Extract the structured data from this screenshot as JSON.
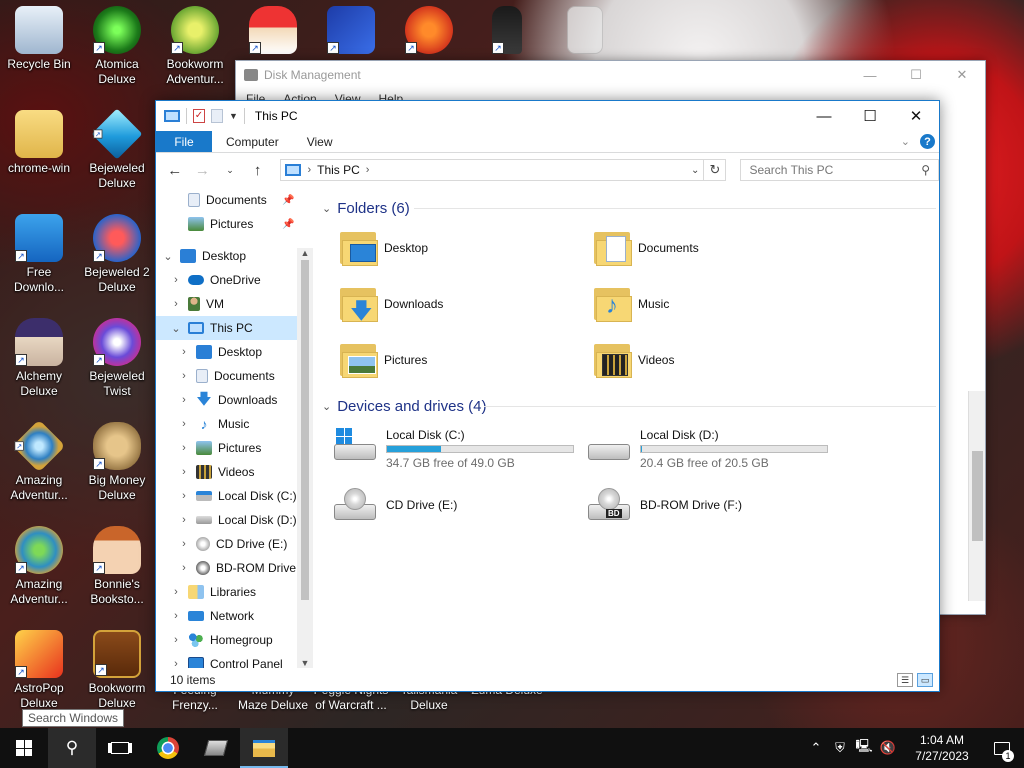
{
  "desktop": {
    "icons": [
      {
        "label": "Recycle Bin",
        "icon": "recycle-bin-icon"
      },
      {
        "label": "Atomica\nDeluxe",
        "icon": "atomica-icon"
      },
      {
        "label": "Bookworm\nAdventur...",
        "icon": "bookworm-adventures-icon"
      },
      {
        "label": "chrome-win",
        "icon": "folder-icon"
      },
      {
        "label": "Bejeweled\nDeluxe",
        "icon": "bejeweled-icon"
      },
      {
        "label": "Free\nDownlo...",
        "icon": "free-download-icon"
      },
      {
        "label": "Bejeweled 2\nDeluxe",
        "icon": "bejeweled-2-icon"
      },
      {
        "label": "Alchemy\nDeluxe",
        "icon": "alchemy-icon"
      },
      {
        "label": "Bejeweled\nTwist",
        "icon": "bejeweled-twist-icon"
      },
      {
        "label": "Amazing\nAdventur...",
        "icon": "amazing-adventures-icon"
      },
      {
        "label": "Big Money\nDeluxe",
        "icon": "big-money-icon"
      },
      {
        "label": "Amazing\nAdventur...",
        "icon": "amazing-adventures-2-icon"
      },
      {
        "label": "Bonnie's\nBooksto...",
        "icon": "bonnies-bookstore-icon"
      },
      {
        "label": "AstroPop\nDeluxe",
        "icon": "astropop-icon"
      },
      {
        "label": "Bookworm\nDeluxe",
        "icon": "bookworm-deluxe-icon"
      }
    ],
    "hidden_labels": [
      "Feeding\nFrenzy...",
      "Mummy\nMaze Deluxe",
      "Peggle Nights\nof Warcraft ...",
      "Talismania\nDeluxe",
      "Zuma Deluxe"
    ],
    "tooltip": "Search Windows"
  },
  "disk_management": {
    "title": "Disk Management",
    "menu": [
      "File",
      "Action",
      "View",
      "Help"
    ]
  },
  "explorer": {
    "title": "This PC",
    "ribbon_tabs": [
      "File",
      "Computer",
      "View"
    ],
    "address": {
      "crumb": "This PC"
    },
    "search_placeholder": "Search This PC",
    "nav": [
      {
        "label": "Documents",
        "icon": "documents-icon",
        "pinned": true
      },
      {
        "label": "Pictures",
        "icon": "pictures-icon",
        "pinned": true
      },
      {
        "label": "Desktop",
        "icon": "desktop-icon"
      },
      {
        "label": "OneDrive",
        "icon": "onedrive-icon"
      },
      {
        "label": "VM",
        "icon": "user-icon"
      },
      {
        "label": "This PC",
        "icon": "this-pc-icon"
      },
      {
        "label": "Desktop",
        "icon": "desktop-icon"
      },
      {
        "label": "Documents",
        "icon": "documents-icon"
      },
      {
        "label": "Downloads",
        "icon": "downloads-icon"
      },
      {
        "label": "Music",
        "icon": "music-icon"
      },
      {
        "label": "Pictures",
        "icon": "pictures-icon"
      },
      {
        "label": "Videos",
        "icon": "videos-icon"
      },
      {
        "label": "Local Disk (C:)",
        "icon": "hard-drive-icon"
      },
      {
        "label": "Local Disk (D:)",
        "icon": "hard-drive-icon"
      },
      {
        "label": "CD Drive (E:)",
        "icon": "cd-drive-icon"
      },
      {
        "label": "BD-ROM Drive",
        "icon": "bd-drive-icon"
      },
      {
        "label": "Libraries",
        "icon": "libraries-icon"
      },
      {
        "label": "Network",
        "icon": "network-icon"
      },
      {
        "label": "Homegroup",
        "icon": "homegroup-icon"
      },
      {
        "label": "Control Panel",
        "icon": "control-panel-icon"
      }
    ],
    "folders_header": "Folders (6)",
    "folders": [
      {
        "name": "Desktop",
        "icon": "desktop-folder-icon"
      },
      {
        "name": "Documents",
        "icon": "documents-folder-icon"
      },
      {
        "name": "Downloads",
        "icon": "downloads-folder-icon"
      },
      {
        "name": "Music",
        "icon": "music-folder-icon"
      },
      {
        "name": "Pictures",
        "icon": "pictures-folder-icon"
      },
      {
        "name": "Videos",
        "icon": "videos-folder-icon"
      }
    ],
    "drives_header": "Devices and drives (4)",
    "drives": [
      {
        "name": "Local Disk (C:)",
        "free": "34.7 GB free of 49.0 GB",
        "used_fraction": 0.29,
        "icon": "windows-drive-icon"
      },
      {
        "name": "Local Disk (D:)",
        "free": "20.4 GB free of 20.5 GB",
        "used_fraction": 0.005,
        "icon": "hard-drive-icon"
      },
      {
        "name": "CD Drive (E:)",
        "icon": "cd-drive-icon"
      },
      {
        "name": "BD-ROM Drive (F:)",
        "icon": "bd-drive-icon"
      }
    ],
    "status": "10 items"
  },
  "taskbar": {
    "clock_time": "1:04 AM",
    "clock_date": "7/27/2023",
    "notification_count": "1",
    "accent": "#76b9ed"
  }
}
